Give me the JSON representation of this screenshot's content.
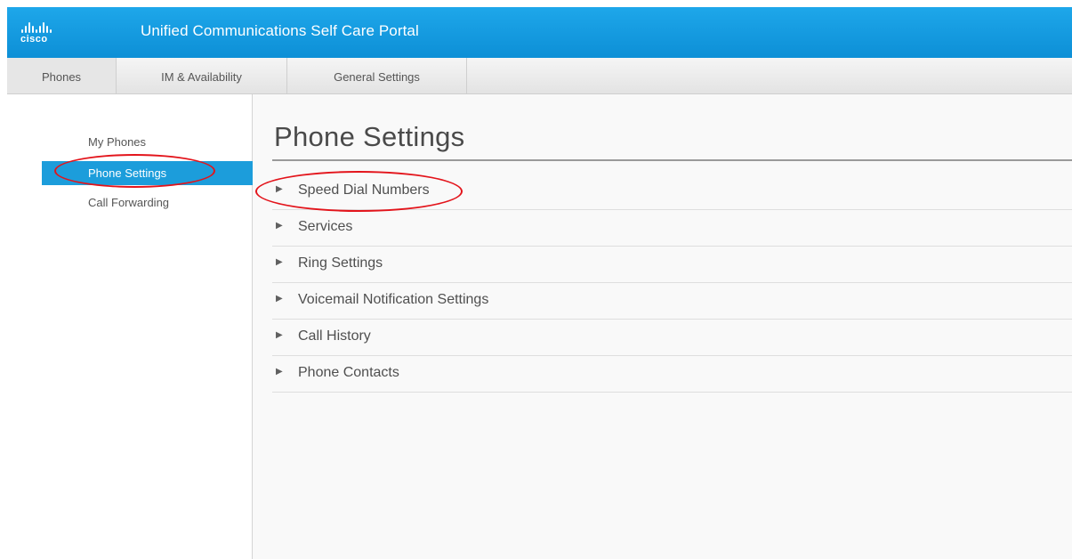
{
  "header": {
    "logo_text": "cisco",
    "title": "Unified Communications Self Care Portal"
  },
  "tabs": [
    {
      "label": "Phones",
      "active": true
    },
    {
      "label": "IM & Availability",
      "active": false
    },
    {
      "label": "General Settings",
      "active": false
    }
  ],
  "sidebar": {
    "items": [
      {
        "label": "My Phones",
        "active": false
      },
      {
        "label": "Phone Settings",
        "active": true
      },
      {
        "label": "Call Forwarding",
        "active": false
      }
    ]
  },
  "main": {
    "title": "Phone Settings",
    "sections": [
      {
        "label": "Speed Dial Numbers",
        "icon": "triangle-right-icon"
      },
      {
        "label": "Services",
        "icon": "triangle-right-icon"
      },
      {
        "label": "Ring Settings",
        "icon": "triangle-right-icon"
      },
      {
        "label": "Voicemail Notification Settings",
        "icon": "triangle-right-icon"
      },
      {
        "label": "Call History",
        "icon": "triangle-right-icon"
      },
      {
        "label": "Phone Contacts",
        "icon": "triangle-right-icon"
      }
    ]
  },
  "colors": {
    "header_blue": "#0d8fd6",
    "active_nav_blue": "#1c9ddb",
    "annotation_red": "#e3141b"
  }
}
